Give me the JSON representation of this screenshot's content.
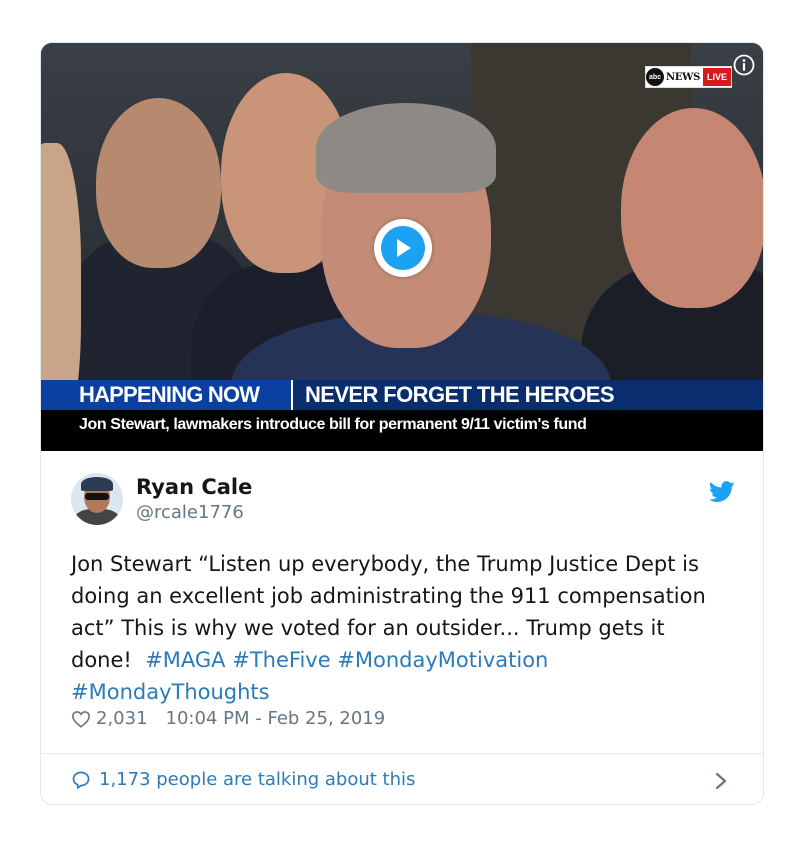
{
  "media": {
    "logo_abc": "abc",
    "logo_news": "NEWS",
    "logo_live": "LIVE",
    "banner_left": "HAPPENING NOW",
    "banner_right": "NEVER FORGET THE HEROES",
    "banner_sub": "Jon Stewart, lawmakers introduce bill for permanent 9/11 victim's fund",
    "play_icon": "play-icon",
    "info_icon": "info-icon"
  },
  "tweet": {
    "author_name": "Ryan Cale",
    "author_handle": "@rcale1776",
    "text_plain": "Jon Stewart “Listen up everybody, the Trump Justice Dept is doing an excellent job administrating the 911 compensation act” This is why we voted for an outsider... Trump gets it done!",
    "hashtags": [
      "#MAGA",
      "#TheFive",
      "#MondayMotivation",
      "#MondayThoughts"
    ],
    "likes": "2,031",
    "timestamp": "10:04 PM - Feb 25, 2019",
    "talking": "1,173 people are talking about this"
  },
  "colors": {
    "link": "#2b7bb9",
    "twitter_blue": "#1da1f2",
    "text": "#14171a",
    "muted": "#657786",
    "banner_blue": "#0b3fa0"
  }
}
